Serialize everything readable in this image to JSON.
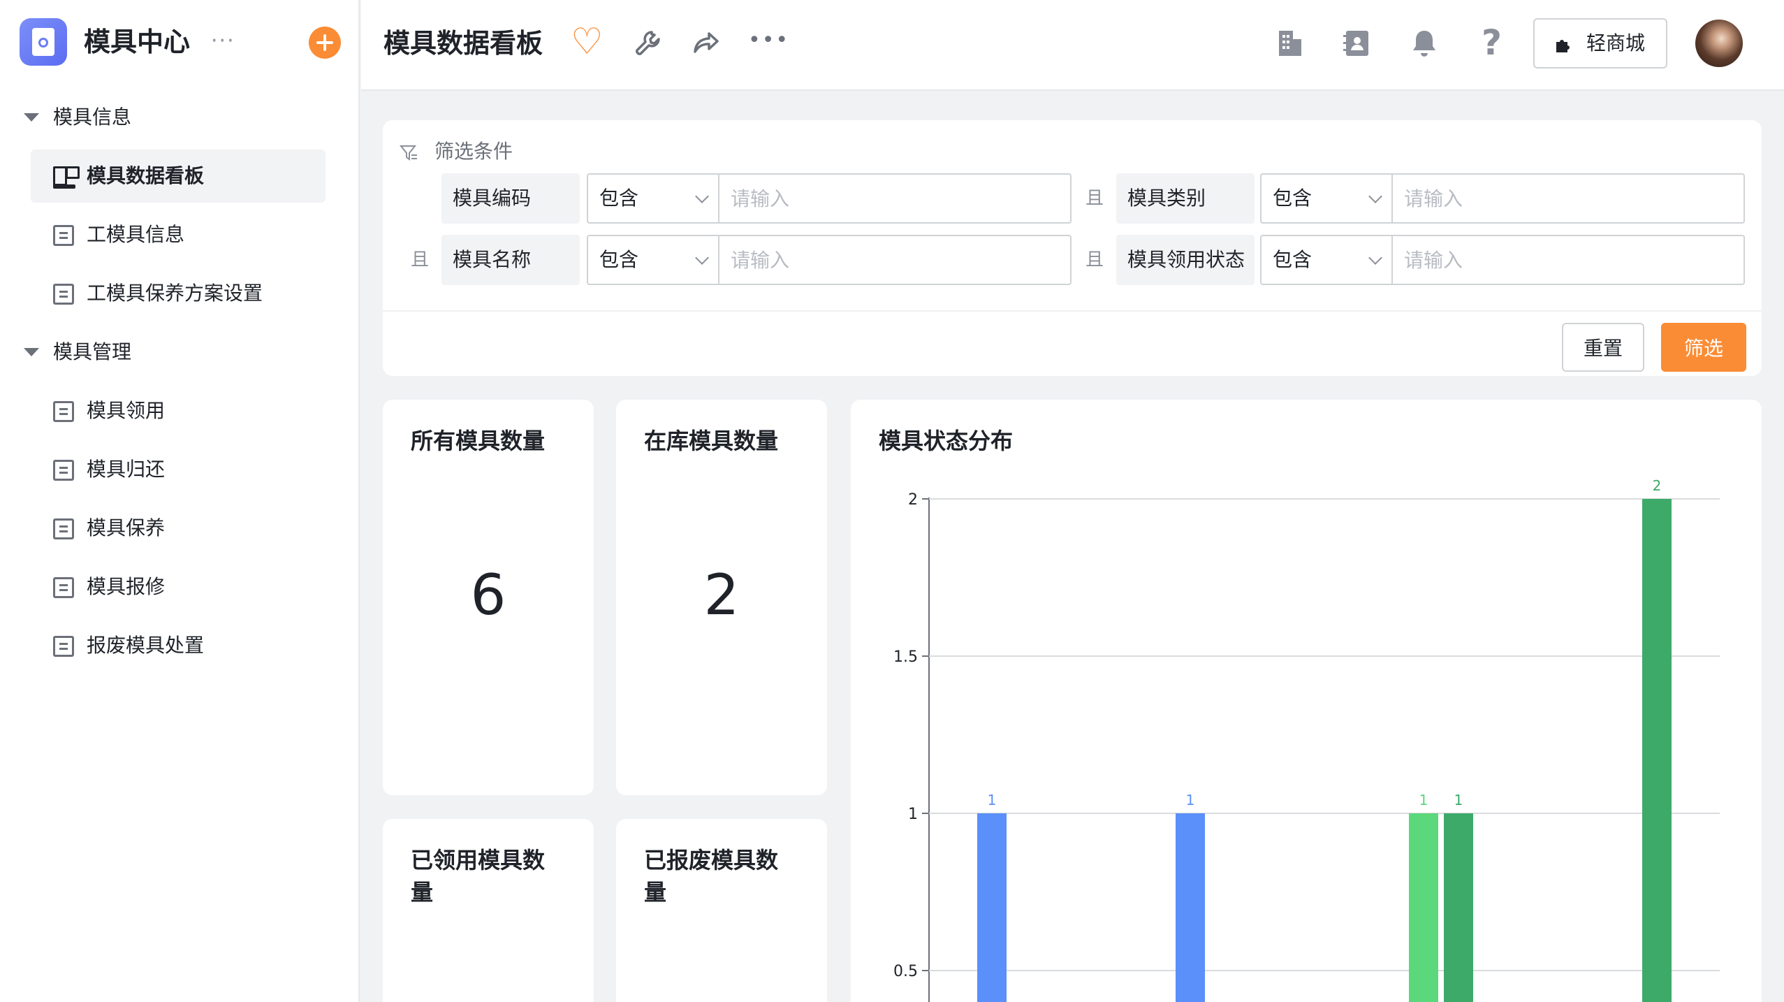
{
  "app": {
    "title": "模具中心",
    "more": "···"
  },
  "sidebar": {
    "groups": [
      {
        "label": "模具信息",
        "items": [
          "模具数据看板",
          "工模具信息",
          "工模具保养方案设置"
        ]
      },
      {
        "label": "模具管理",
        "items": [
          "模具领用",
          "模具归还",
          "模具保养",
          "模具报修",
          "报废模具处置"
        ]
      }
    ],
    "active_item": "模具数据看板"
  },
  "topbar": {
    "title": "模具数据看板",
    "mall_label": "轻商城"
  },
  "filter": {
    "title": "筛选条件",
    "and_label": "且",
    "rows": [
      [
        {
          "field": "模具编码",
          "op": "包含",
          "placeholder": "请输入"
        },
        {
          "field": "模具类别",
          "op": "包含",
          "placeholder": "请输入"
        }
      ],
      [
        {
          "field": "模具名称",
          "op": "包含",
          "placeholder": "请输入"
        },
        {
          "field": "模具领用状态",
          "op": "包含",
          "placeholder": "请输入"
        }
      ]
    ],
    "reset_label": "重置",
    "submit_label": "筛选"
  },
  "cards": [
    {
      "title": "所有模具数量",
      "value": "6"
    },
    {
      "title": "在库模具数量",
      "value": "2"
    },
    {
      "title": "已领用模具数量",
      "value": ""
    },
    {
      "title": "已报废模具数量",
      "value": ""
    }
  ],
  "chart_data": {
    "type": "bar",
    "title": "模具状态分布",
    "ylim": [
      0,
      2
    ],
    "yticks": [
      "0.5",
      "1",
      "1.5",
      "2"
    ],
    "grid": true,
    "bars": [
      {
        "value": 1,
        "label": "1",
        "color": "#5b8ff9"
      },
      {
        "value": 1,
        "label": "1",
        "color": "#5b8ff9"
      },
      {
        "value": 1,
        "label": "1",
        "color": "#5ad87b"
      },
      {
        "value": 1,
        "label": "1",
        "color": "#3daa6a"
      },
      {
        "value": 2,
        "label": "2",
        "color": "#3daa6a"
      }
    ]
  },
  "colors": {
    "accent": "#fa8c35"
  }
}
